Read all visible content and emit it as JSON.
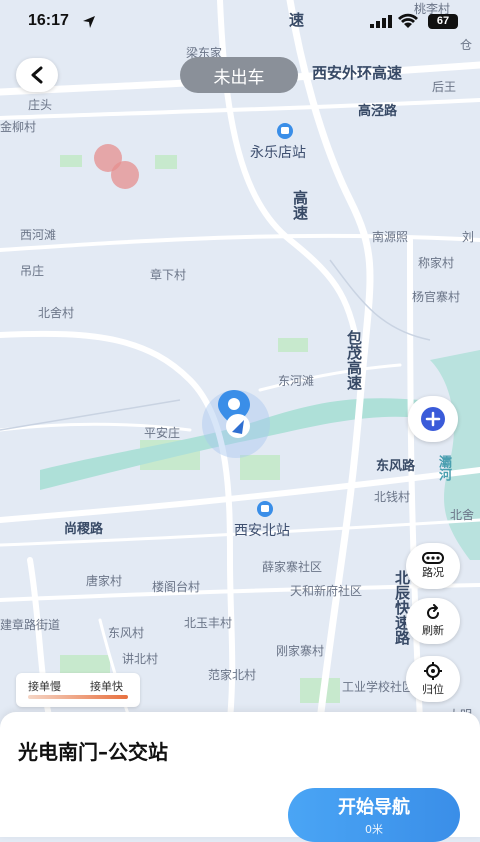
{
  "status_bar": {
    "time": "16:17",
    "battery": "67"
  },
  "header": {
    "status_pill": "未出车"
  },
  "map": {
    "roads": {
      "west_ring": "西安外环高速",
      "jingkou": "高泾路",
      "hu_highway_1": "速",
      "hu_highway_2": "高速",
      "baomao": "包茂高速",
      "dongfeng": "东风路",
      "shanglou": "尚稷路",
      "beichen": "北辰快速路",
      "baoshan": "灞河"
    },
    "places": [
      "桃李村",
      "梁东家",
      "仓",
      "庄头",
      "后王",
      "金柳村",
      "西河滩",
      "南源照",
      "刘",
      "吊庄",
      "章下村",
      "称家村",
      "杨官寨村",
      "北舍村",
      "东河滩",
      "平安庄",
      "北钱村",
      "北舍",
      "唐家村",
      "楼阁台村",
      "薛家寨社区",
      "天和新府社区",
      "建章路街道",
      "东风村",
      "北玉丰村",
      "讲北村",
      "刚家寨村",
      "范家北村",
      "工业学校社区",
      "大明"
    ],
    "stations": {
      "yongle": "永乐店站",
      "xian_north": "西安北站"
    }
  },
  "controls": {
    "road_condition": "路况",
    "refresh": "刷新",
    "locate": "归位"
  },
  "legend": {
    "slow": "接单慢",
    "fast": "接单快"
  },
  "sheet": {
    "destination": "光电南门–公交站",
    "nav_label": "开始导航",
    "distance": "0米"
  },
  "colors": {
    "accent": "#3a8ee8",
    "water": "#aee0d8",
    "green": "#c7e9cd",
    "road": "#ffffff",
    "heat": "#e58f8f"
  }
}
